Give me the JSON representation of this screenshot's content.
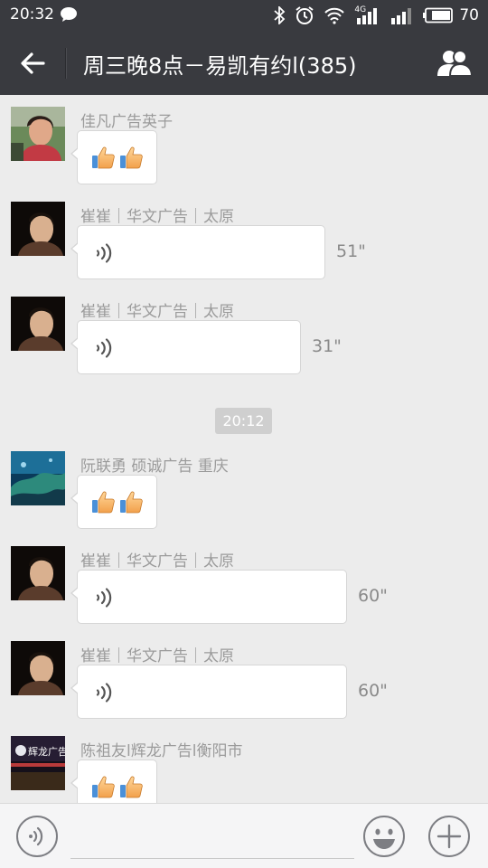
{
  "status_bar": {
    "time": "20:32",
    "network_type": "4G",
    "battery_level": "70"
  },
  "nav": {
    "title": "周三晚8点－易凯有约l(385)"
  },
  "messages": [
    {
      "sender": "佳凡广告英子",
      "type": "thumbs",
      "thumb_count": 2
    },
    {
      "sender": "崔崔｜华文广告｜太原",
      "type": "voice",
      "duration": "51\""
    },
    {
      "sender": "崔崔｜华文广告｜太原",
      "type": "voice",
      "duration": "31\""
    },
    {
      "sender": "阮联勇 硕诚广告 重庆",
      "type": "thumbs",
      "thumb_count": 2
    },
    {
      "sender": "崔崔｜华文广告｜太原",
      "type": "voice",
      "duration": "60\""
    },
    {
      "sender": "崔崔｜华文广告｜太原",
      "type": "voice",
      "duration": "60\""
    },
    {
      "sender": "陈祖友l辉龙广告l衡阳市",
      "type": "thumbs",
      "thumb_count": 2
    }
  ],
  "timestamp": "20:12",
  "avatar_sign_text": "辉龙广告",
  "colors": {
    "header_bg": "#393a3f",
    "chat_bg": "#ececec",
    "sender_text": "#9b9b9b",
    "timestamp_bg": "#cfcfcf"
  },
  "icons": {
    "back": "arrow-left-icon",
    "members": "group-members-icon",
    "voice": "voice-wave-icon",
    "emoji": "smiley-icon",
    "plus": "plus-icon"
  }
}
